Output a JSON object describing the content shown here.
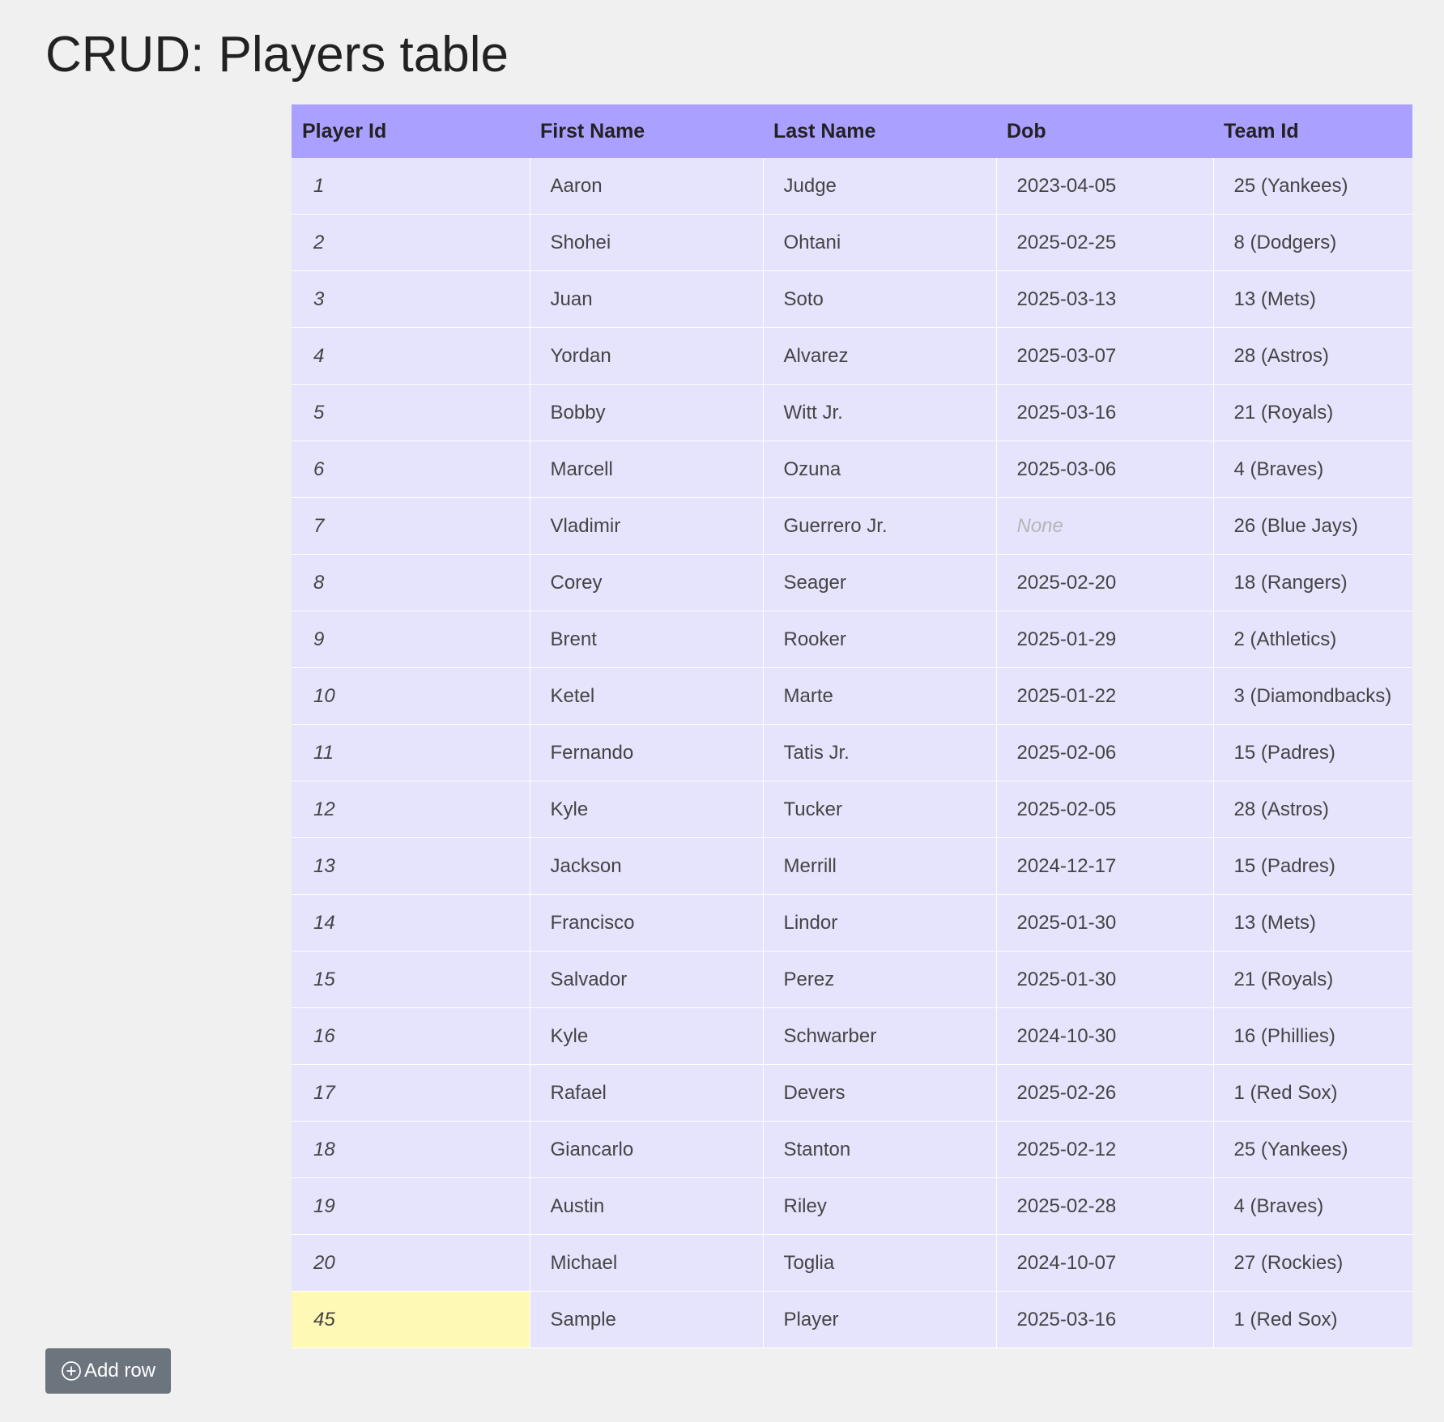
{
  "page": {
    "title": "CRUD: Players table"
  },
  "table": {
    "columns": [
      "Player Id",
      "First Name",
      "Last Name",
      "Dob",
      "Team Id"
    ],
    "rows": [
      {
        "player_id": "1",
        "first_name": "Aaron",
        "last_name": "Judge",
        "dob": "2023-04-05",
        "team": "25 (Yankees)"
      },
      {
        "player_id": "2",
        "first_name": "Shohei",
        "last_name": "Ohtani",
        "dob": "2025-02-25",
        "team": "8 (Dodgers)"
      },
      {
        "player_id": "3",
        "first_name": "Juan",
        "last_name": "Soto",
        "dob": "2025-03-13",
        "team": "13 (Mets)"
      },
      {
        "player_id": "4",
        "first_name": "Yordan",
        "last_name": "Alvarez",
        "dob": "2025-03-07",
        "team": "28 (Astros)"
      },
      {
        "player_id": "5",
        "first_name": "Bobby",
        "last_name": "Witt Jr.",
        "dob": "2025-03-16",
        "team": "21 (Royals)"
      },
      {
        "player_id": "6",
        "first_name": "Marcell",
        "last_name": "Ozuna",
        "dob": "2025-03-06",
        "team": "4 (Braves)"
      },
      {
        "player_id": "7",
        "first_name": "Vladimir",
        "last_name": "Guerrero Jr.",
        "dob": "None",
        "dob_is_null": true,
        "team": "26 (Blue Jays)"
      },
      {
        "player_id": "8",
        "first_name": "Corey",
        "last_name": "Seager",
        "dob": "2025-02-20",
        "team": "18 (Rangers)"
      },
      {
        "player_id": "9",
        "first_name": "Brent",
        "last_name": "Rooker",
        "dob": "2025-01-29",
        "team": "2 (Athletics)"
      },
      {
        "player_id": "10",
        "first_name": "Ketel",
        "last_name": "Marte",
        "dob": "2025-01-22",
        "team": "3 (Diamondbacks)"
      },
      {
        "player_id": "11",
        "first_name": "Fernando",
        "last_name": "Tatis Jr.",
        "dob": "2025-02-06",
        "team": "15 (Padres)"
      },
      {
        "player_id": "12",
        "first_name": "Kyle",
        "last_name": "Tucker",
        "dob": "2025-02-05",
        "team": "28 (Astros)"
      },
      {
        "player_id": "13",
        "first_name": "Jackson",
        "last_name": "Merrill",
        "dob": "2024-12-17",
        "team": "15 (Padres)"
      },
      {
        "player_id": "14",
        "first_name": "Francisco",
        "last_name": "Lindor",
        "dob": "2025-01-30",
        "team": "13 (Mets)"
      },
      {
        "player_id": "15",
        "first_name": "Salvador",
        "last_name": "Perez",
        "dob": "2025-01-30",
        "team": "21 (Royals)"
      },
      {
        "player_id": "16",
        "first_name": "Kyle",
        "last_name": "Schwarber",
        "dob": "2024-10-30",
        "team": "16 (Phillies)"
      },
      {
        "player_id": "17",
        "first_name": "Rafael",
        "last_name": "Devers",
        "dob": "2025-02-26",
        "team": "1 (Red Sox)"
      },
      {
        "player_id": "18",
        "first_name": "Giancarlo",
        "last_name": "Stanton",
        "dob": "2025-02-12",
        "team": "25 (Yankees)"
      },
      {
        "player_id": "19",
        "first_name": "Austin",
        "last_name": "Riley",
        "dob": "2025-02-28",
        "team": "4 (Braves)"
      },
      {
        "player_id": "20",
        "first_name": "Michael",
        "last_name": "Toglia",
        "dob": "2024-10-07",
        "team": "27 (Rockies)"
      },
      {
        "player_id": "45",
        "first_name": "Sample",
        "last_name": "Player",
        "dob": "2025-03-16",
        "team": "1 (Red Sox)",
        "highlighted": true
      }
    ]
  },
  "actions": {
    "add_row_label": "Add row",
    "add_row_icon": "plus-circle-icon"
  },
  "colors": {
    "page_background": "#f0f0f0",
    "header_background": "#aaa0ff",
    "row_background": "#e6e3fd",
    "highlight_cell": "#fef9b4",
    "button_background": "#6c757d",
    "null_value_text": "#b5b5b5"
  }
}
